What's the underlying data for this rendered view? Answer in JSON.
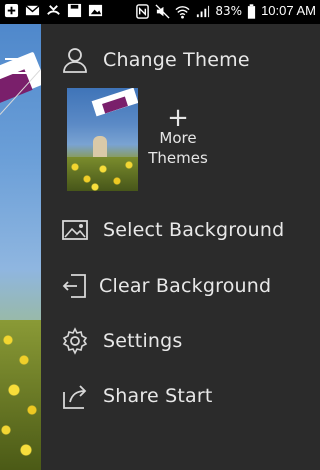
{
  "status_bar": {
    "battery": "83%",
    "time": "10:07 AM"
  },
  "drawer": {
    "change_theme": "Change Theme",
    "more_themes_line1": "More",
    "more_themes_line2": "Themes",
    "items": [
      {
        "label": "Select Background",
        "icon": "image-icon"
      },
      {
        "label": "Clear Background",
        "icon": "exit-icon"
      },
      {
        "label": "Settings",
        "icon": "gear-icon"
      },
      {
        "label": "Share Start",
        "icon": "share-icon"
      }
    ]
  },
  "colors": {
    "drawer_bg": "#2b2b2b",
    "text": "#e8e8e8",
    "status_bar_bg": "#000000"
  }
}
